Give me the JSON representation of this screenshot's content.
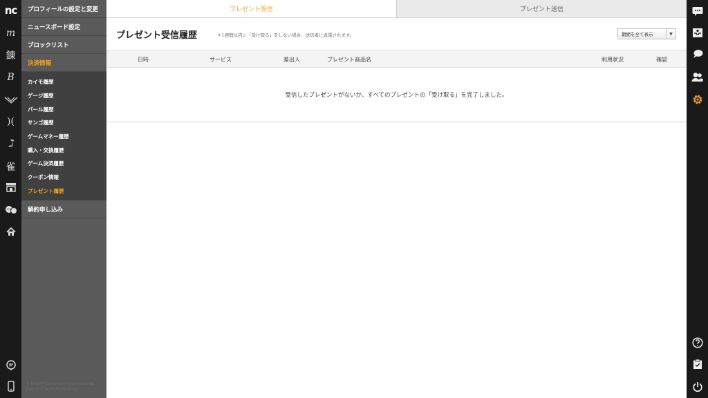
{
  "left_rail": {
    "logo": "nc",
    "items": [
      {
        "icon": "lineage-m-icon",
        "glyph": "m"
      },
      {
        "icon": "lineage-icon",
        "glyph": "錬"
      },
      {
        "icon": "bns-icon",
        "glyph": "B"
      },
      {
        "icon": "aion-icon",
        "glyph": "W"
      },
      {
        "icon": "lineage2-icon",
        "glyph": ")("
      },
      {
        "icon": "guild-wars-icon",
        "glyph": "ℷ"
      },
      {
        "icon": "taiga-icon",
        "glyph": "雀"
      },
      {
        "icon": "shop-icon"
      },
      {
        "icon": "characters-icon"
      },
      {
        "icon": "home-icon"
      }
    ],
    "bottom": [
      {
        "icon": "chat-bulb-icon"
      },
      {
        "icon": "mobile-icon"
      }
    ]
  },
  "menu": {
    "top_items": [
      {
        "label": "プロフィールの設定と変更"
      },
      {
        "label": "ニュースボード設定"
      },
      {
        "label": "ブロックリスト"
      },
      {
        "label": "決済情報"
      }
    ],
    "sub_items": [
      {
        "label": "カイモ履歴"
      },
      {
        "label": "ゲージ履歴"
      },
      {
        "label": "パール履歴"
      },
      {
        "label": "サンゴ履歴"
      },
      {
        "label": "ゲームマネー履歴"
      },
      {
        "label": "購入・交換履歴"
      },
      {
        "label": "ゲーム決済履歴"
      },
      {
        "label": "クーポン情報"
      },
      {
        "label": "プレゼント履歴"
      }
    ],
    "bottom_item": {
      "label": "解約申し込み"
    },
    "copyright": "© NCSOFT Corporation. Licensed to NC Japan K.K. All Rights Reserved."
  },
  "tabs": {
    "received": "プレゼント受信",
    "sent": "プレゼント送信"
  },
  "header": {
    "title": "プレゼント受信履歴",
    "note": "＊1週間以内に「受け取る」をしない場合、送信者に返還されます。",
    "period_select": "期間を全て表示"
  },
  "table": {
    "columns": [
      "日時",
      "サービス",
      "差出人",
      "プレゼント商品名",
      "利用状況",
      "確認"
    ],
    "empty_message": "受信したプレゼントがないか、すべてのプレゼントの「受け取る」を完了しました。"
  },
  "right_rail": {
    "items": [
      {
        "icon": "chat-icon"
      },
      {
        "icon": "inbox-icon"
      },
      {
        "icon": "messages-icon"
      },
      {
        "icon": "friends-icon"
      },
      {
        "icon": "settings-icon"
      }
    ],
    "bottom": [
      {
        "icon": "help-icon"
      },
      {
        "icon": "clipboard-icon"
      },
      {
        "icon": "power-icon"
      }
    ]
  },
  "colors": {
    "accent": "#f5a21c",
    "rail": "#1a1a1a",
    "menu": "#5a5a5a",
    "submenu": "#404040"
  }
}
